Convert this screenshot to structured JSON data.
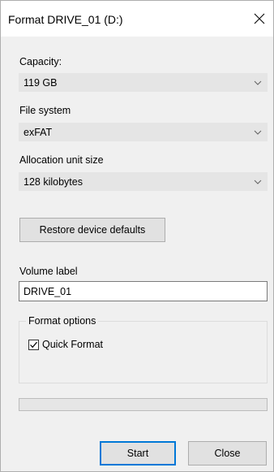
{
  "window": {
    "title": "Format DRIVE_01 (D:)"
  },
  "capacity": {
    "label": "Capacity:",
    "value": "119 GB"
  },
  "file_system": {
    "label": "File system",
    "value": "exFAT"
  },
  "allocation": {
    "label": "Allocation unit size",
    "value": "128 kilobytes"
  },
  "restore_button": {
    "label": "Restore device defaults"
  },
  "volume": {
    "label": "Volume label",
    "value": "DRIVE_01"
  },
  "format_options": {
    "title": "Format options",
    "quick_format_label": "Quick Format",
    "quick_format_checked": true
  },
  "progress": {
    "fraction": 0
  },
  "footer": {
    "start_label": "Start",
    "close_label": "Close"
  },
  "icons": {
    "close": "close-icon",
    "dropdown": "chevron-down-icon",
    "check": "checkmark-icon"
  },
  "colors": {
    "accent": "#0078d7",
    "dialog_bg": "#f0f0f0",
    "combo_bg": "#e5e5e5",
    "button_bg": "#e1e1e1"
  }
}
